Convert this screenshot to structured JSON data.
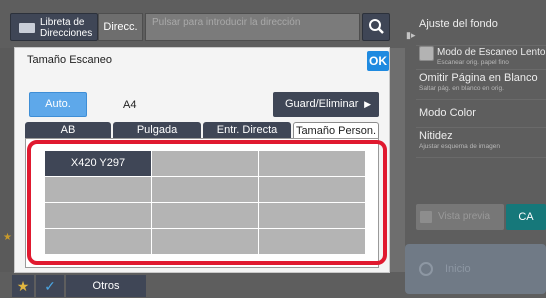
{
  "topbar": {
    "address_book_label": "Libreta de Direcciones",
    "direct_label": "Direcc.",
    "address_placeholder": "Pulsar para introducir la dirección"
  },
  "right_panel": {
    "items": [
      {
        "title": "Ajuste del fondo",
        "subtitle": ""
      },
      {
        "title": "Modo de Escaneo Lento",
        "subtitle": "Escanear orig. papel fino"
      },
      {
        "title": "Omitir Página en Blanco",
        "subtitle": "Saltar pág. en blanco en orig."
      },
      {
        "title": "Modo Color",
        "subtitle": ""
      },
      {
        "title": "Nitidez",
        "subtitle": "Ajustar esquema de imagen"
      }
    ],
    "preview_label": "Vista previa",
    "ca_label": "CA",
    "start_label": "Inicio"
  },
  "bottom_bar": {
    "others_label": "Otros"
  },
  "dialog": {
    "title": "Tamaño Escaneo",
    "ok_label": "OK",
    "auto_label": "Auto.",
    "current_size": "A4",
    "save_delete_label": "Guard/Eliminar",
    "tabs": [
      "AB",
      "Pulgada",
      "Entr. Directa",
      "Tamaño Person."
    ],
    "active_tab": "Tamaño Person.",
    "custom_sizes": [
      "X420 Y297",
      "",
      "",
      "",
      "",
      "",
      "",
      "",
      "",
      "",
      "",
      ""
    ]
  },
  "colors": {
    "dark_button": "#3f4656",
    "accent_blue": "#1f8ae0",
    "highlight_red": "#e0192f",
    "ca_teal": "#16787a"
  }
}
